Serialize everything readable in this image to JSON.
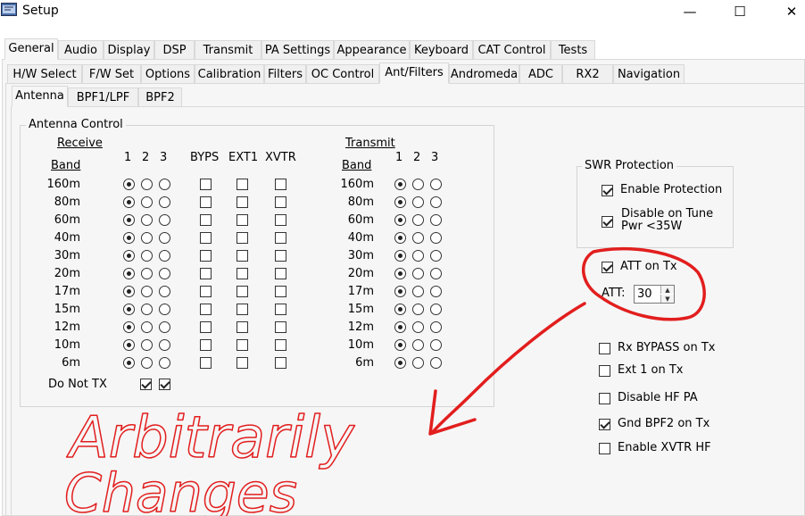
{
  "window": {
    "title": "Setup",
    "minimize_label": "—",
    "maximize_label": "☐",
    "close_label": "✕"
  },
  "tabs_level1": [
    "General",
    "Audio",
    "Display",
    "DSP",
    "Transmit",
    "PA Settings",
    "Appearance",
    "Keyboard",
    "CAT Control",
    "Tests"
  ],
  "tabs_level2": [
    "H/W Select",
    "F/W Set",
    "Options",
    "Calibration",
    "Filters",
    "OC Control",
    "Ant/Filters",
    "Andromeda",
    "ADC",
    "RX2",
    "Navigation"
  ],
  "tabs_level3": [
    "Antenna",
    "BPF1/LPF",
    "BPF2"
  ],
  "antenna_control": {
    "title": "Antenna Control",
    "receive_label": "Receive",
    "transmit_label": "Transmit",
    "band_label": "Band",
    "col_1": "1",
    "col_2": "2",
    "col_3": "3",
    "byps": "BYPS",
    "ext1": "EXT1",
    "xvtr": "XVTR",
    "bands": [
      "160m",
      "80m",
      "60m",
      "40m",
      "30m",
      "20m",
      "17m",
      "15m",
      "12m",
      "10m",
      "6m"
    ],
    "rx_selected": [
      1,
      1,
      1,
      1,
      1,
      1,
      1,
      1,
      1,
      1,
      1
    ],
    "tx_selected": [
      1,
      1,
      1,
      1,
      1,
      1,
      1,
      1,
      1,
      1,
      1
    ],
    "do_not_tx_label": "Do Not TX",
    "do_not_tx_checked": [
      true,
      true
    ]
  },
  "swr_protection": {
    "title": "SWR Protection",
    "enable_protection": {
      "label": "Enable Protection",
      "checked": true
    },
    "disable_on_tune": {
      "label_line1": "Disable on Tune",
      "label_line2": "Pwr <35W",
      "checked": true
    }
  },
  "att_on_tx": {
    "label": "ATT on Tx",
    "checked": true
  },
  "att": {
    "label": "ATT:",
    "value": "30"
  },
  "options": [
    {
      "label": "Rx BYPASS on Tx",
      "checked": false
    },
    {
      "label": "Ext 1 on Tx",
      "checked": false
    },
    {
      "label": "Disable HF PA",
      "checked": false
    },
    {
      "label": "Gnd BPF2 on Tx",
      "checked": true
    },
    {
      "label": "Enable XVTR HF",
      "checked": false
    }
  ],
  "annotation": {
    "text_line1": "Arbitrarily",
    "text_line2": "Changes",
    "color": "#e21e1e"
  }
}
